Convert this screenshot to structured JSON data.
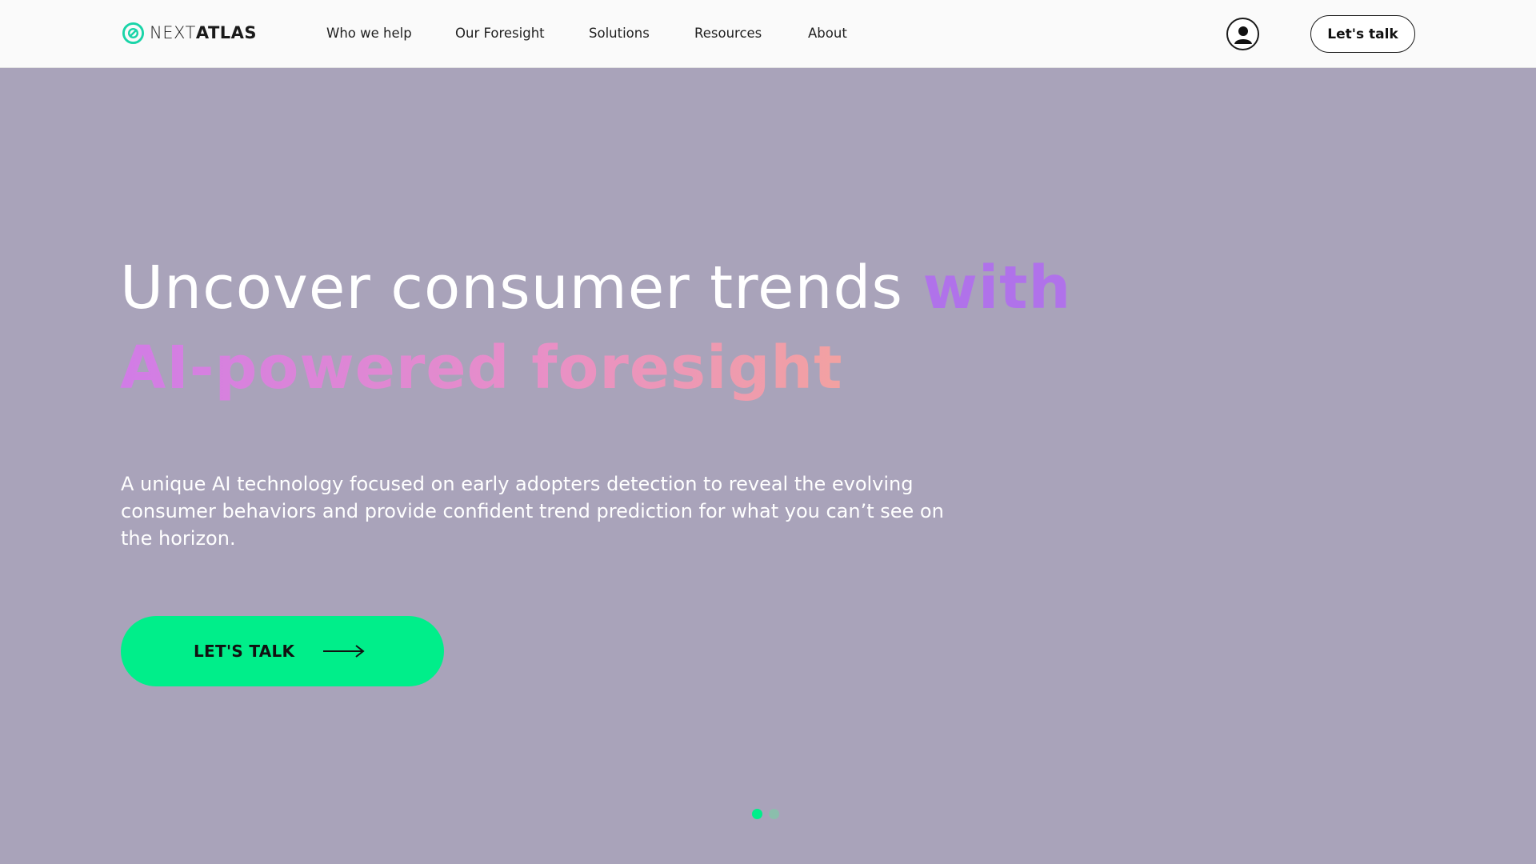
{
  "header": {
    "logo": {
      "thin": "NEXT",
      "bold": "ATLAS",
      "icon": "nextatlas-logo-icon"
    },
    "nav": [
      {
        "label": "Who we help"
      },
      {
        "label": "Our Foresight"
      },
      {
        "label": "Solutions"
      },
      {
        "label": "Resources"
      },
      {
        "label": "About"
      }
    ],
    "user_icon": "user-account-icon",
    "cta_label": "Let's talk"
  },
  "hero": {
    "title_plain": "Uncover consumer trends ",
    "title_accent": "with",
    "title_line2": "AI-powered foresight",
    "subtitle": "A unique AI technology focused on early adopters detection to reveal the evolving consumer behaviors and provide confident trend prediction for what you can’t see on the horizon.",
    "cta_label": "LET'S TALK",
    "cta_icon": "arrow-right-icon"
  },
  "carousel": {
    "slides": 2,
    "active_index": 0
  },
  "colors": {
    "background": "#a9a3ba",
    "header_bg": "#fafafa",
    "accent_green": "#00ee8a",
    "accent_purple": "#b072ea",
    "gradient_start": "#d17ce6",
    "gradient_end": "#f7b18c",
    "dot_inactive": "#7fc9a6"
  }
}
